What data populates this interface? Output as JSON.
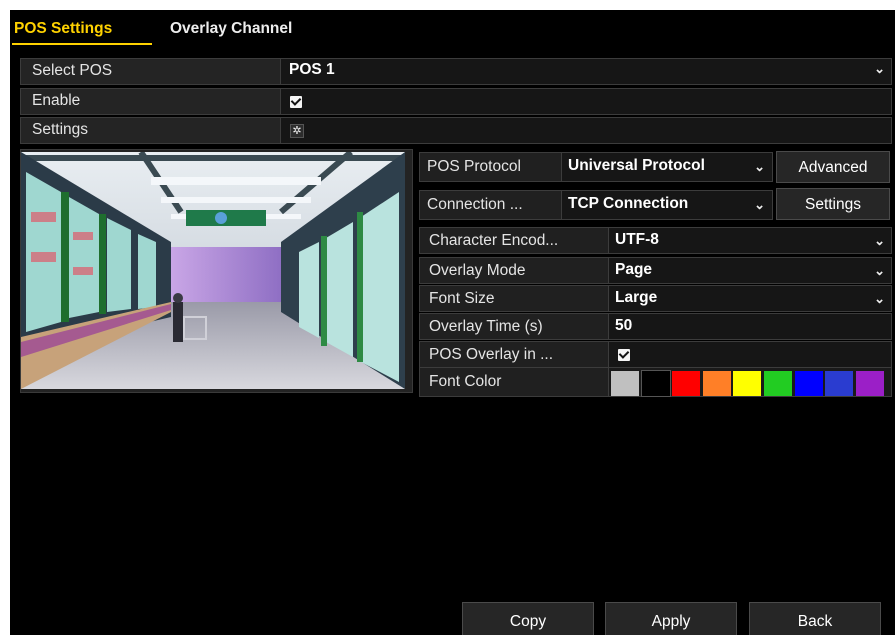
{
  "tabs": [
    {
      "label": "POS Settings",
      "active": true
    },
    {
      "label": "Overlay Channel",
      "active": false
    }
  ],
  "select_pos": {
    "label": "Select POS",
    "value": "POS 1"
  },
  "enable": {
    "label": "Enable",
    "checked": true
  },
  "settings": {
    "label": "Settings"
  },
  "pos_protocol": {
    "label": "POS Protocol",
    "value": "Universal Protocol",
    "button": "Advanced"
  },
  "connection": {
    "label": "Connection ...",
    "value": "TCP Connection",
    "button": "Settings"
  },
  "character_encoding": {
    "label": "Character Encod...",
    "value": "UTF-8"
  },
  "overlay_mode": {
    "label": "Overlay Mode",
    "value": "Page"
  },
  "font_size": {
    "label": "Font Size",
    "value": "Large"
  },
  "overlay_time": {
    "label": "Overlay Time (s)",
    "value": "50"
  },
  "pos_overlay": {
    "label": "POS Overlay in ...",
    "checked": true
  },
  "font_color": {
    "label": "Font Color",
    "colors": [
      "#c0c0c0",
      "#000000",
      "#ff0000",
      "#ff7f27",
      "#ffff00",
      "#22cc22",
      "#0000ff",
      "#2a3cd0",
      "#9b1fc7"
    ]
  },
  "actions": {
    "copy": "Copy",
    "apply": "Apply",
    "back": "Back"
  }
}
